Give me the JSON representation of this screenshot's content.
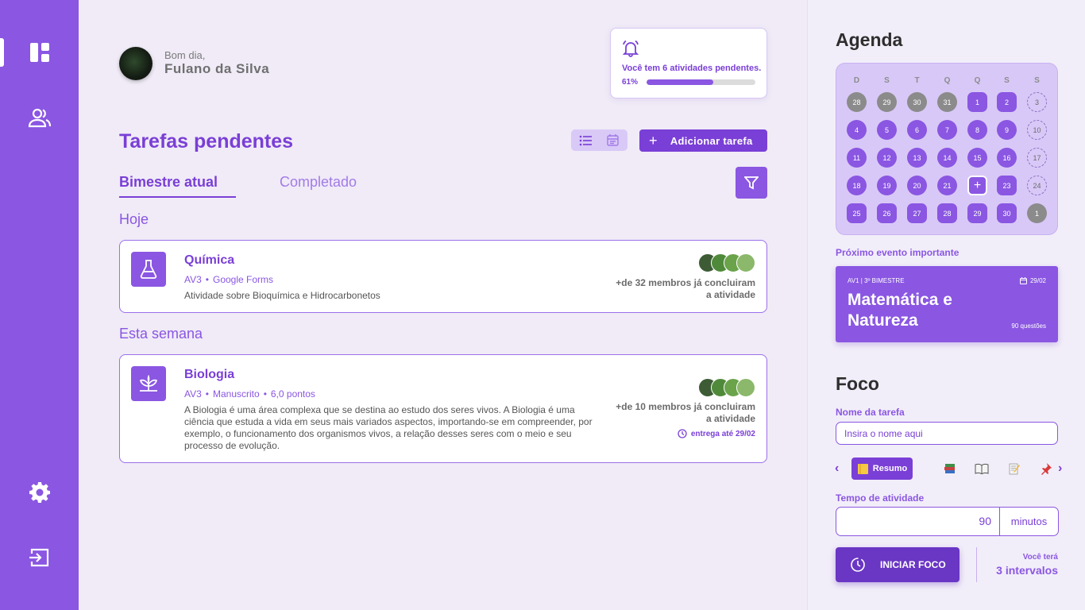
{
  "header": {
    "greeting": "Bom dia,",
    "user_name": "Fulano da Silva"
  },
  "notification": {
    "text_prefix": "Você tem ",
    "count_text": "6 atividades pendentes.",
    "progress_label": "61%",
    "progress": 0.61
  },
  "tasks": {
    "title": "Tarefas pendentes",
    "add_button": "Adicionar tarefa",
    "tabs": [
      {
        "label": "Bimestre atual",
        "active": true
      },
      {
        "label": "Completado",
        "active": false
      }
    ],
    "groups": [
      {
        "label": "Hoje",
        "items": [
          {
            "title": "Química",
            "type": "AV3",
            "platform": "Google Forms",
            "description": "Atividade sobre Bioquímica e Hidrocarbonetos",
            "members_line1": "+de 32 membros já concluiram",
            "members_line2": "a atividade",
            "icon": "flask-icon"
          }
        ]
      },
      {
        "label": "Esta semana",
        "items": [
          {
            "title": "Biologia",
            "type": "AV3",
            "platform": "Manuscrito",
            "points": "6,0 pontos",
            "description": "A Biologia é uma área complexa que se destina ao estudo dos seres vivos. A Biologia é uma ciência que estuda a vida em seus mais variados aspectos, importando-se em compreender, por exemplo, o funcionamento dos organismos vivos, a relação desses seres com o meio e seu processo de evolução.",
            "members_line1": "+de 10 membros já concluiram",
            "members_line2": "a atividade",
            "due": "entrega até 29/02",
            "icon": "plant-icon"
          }
        ]
      }
    ]
  },
  "agenda": {
    "title": "Agenda",
    "weekdays": [
      "D",
      "S",
      "T",
      "Q",
      "Q",
      "S",
      "S"
    ],
    "days": [
      {
        "label": "28",
        "style": "grey"
      },
      {
        "label": "29",
        "style": "grey"
      },
      {
        "label": "30",
        "style": "grey"
      },
      {
        "label": "31",
        "style": "grey"
      },
      {
        "label": "1",
        "style": "purple-sq"
      },
      {
        "label": "2",
        "style": "purple-sq"
      },
      {
        "label": "3",
        "style": "dash"
      },
      {
        "label": "4",
        "style": "purple"
      },
      {
        "label": "5",
        "style": "purple"
      },
      {
        "label": "6",
        "style": "purple"
      },
      {
        "label": "7",
        "style": "purple"
      },
      {
        "label": "8",
        "style": "purple"
      },
      {
        "label": "9",
        "style": "purple"
      },
      {
        "label": "10",
        "style": "dash"
      },
      {
        "label": "11",
        "style": "purple"
      },
      {
        "label": "12",
        "style": "purple"
      },
      {
        "label": "13",
        "style": "purple"
      },
      {
        "label": "14",
        "style": "purple"
      },
      {
        "label": "15",
        "style": "purple"
      },
      {
        "label": "16",
        "style": "purple"
      },
      {
        "label": "17",
        "style": "dash"
      },
      {
        "label": "18",
        "style": "purple"
      },
      {
        "label": "19",
        "style": "purple"
      },
      {
        "label": "20",
        "style": "purple"
      },
      {
        "label": "21",
        "style": "purple"
      },
      {
        "label": "+",
        "style": "today"
      },
      {
        "label": "23",
        "style": "purple-sq"
      },
      {
        "label": "24",
        "style": "dash"
      },
      {
        "label": "25",
        "style": "purple-sq"
      },
      {
        "label": "26",
        "style": "purple-sq"
      },
      {
        "label": "27",
        "style": "purple-sq"
      },
      {
        "label": "28",
        "style": "purple-sq"
      },
      {
        "label": "29",
        "style": "purple-sq"
      },
      {
        "label": "30",
        "style": "purple-sq"
      },
      {
        "label": "1",
        "style": "grey"
      }
    ],
    "next_event_label": "Próximo evento importante",
    "event": {
      "tag": "AV1 | 3º BIMESTRE",
      "date": "29/02",
      "title": "Matemática e Natureza",
      "questions": "90 questões"
    }
  },
  "focus": {
    "title": "Foco",
    "task_name_label": "Nome da tarefa",
    "task_name_placeholder": "Insira o nome aqui",
    "chips": [
      {
        "label": "Resumo",
        "icon": "notepad-icon",
        "active": true
      },
      {
        "icon": "books-icon"
      },
      {
        "icon": "open-book-icon"
      },
      {
        "icon": "memo-icon"
      },
      {
        "icon": "pushpin-icon"
      }
    ],
    "time_label": "Tempo de atividade",
    "time_value": "90",
    "time_unit": "minutos",
    "start_button": "INICIAR FOCO",
    "intervals_label": "Você terá",
    "intervals_value": "3 intervalos"
  },
  "colors": {
    "primary": "#8a56e2",
    "primary_dark": "#7a3fd6",
    "background": "#f0ebf7"
  }
}
